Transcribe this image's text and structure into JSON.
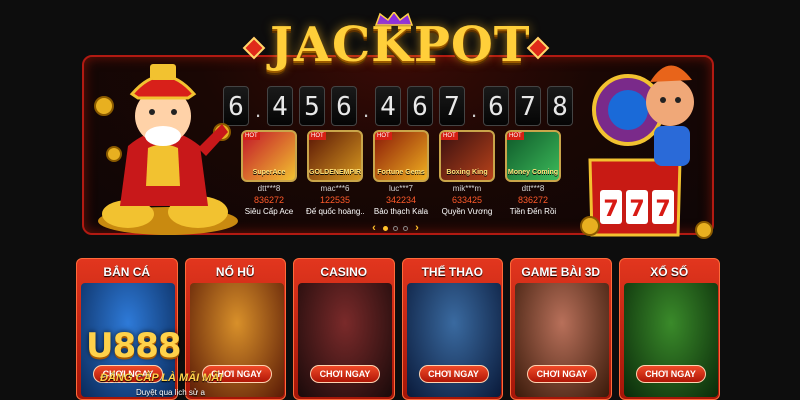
{
  "jackpot": {
    "title": "JACKPOT",
    "digits": [
      "6",
      "4",
      "5",
      "6",
      "4",
      "6",
      "7",
      "6",
      "7",
      "8"
    ],
    "separators": [
      ".",
      ".",
      "."
    ]
  },
  "games": [
    {
      "badge": "HOT",
      "thumb_text": "SuperAce",
      "user": "dtt***8",
      "score": "836272",
      "title": "Siêu Cấp Ace",
      "colors": [
        "#c2172a",
        "#f2c230"
      ]
    },
    {
      "badge": "HOT",
      "thumb_text": "GOLDENEMPIRE",
      "user": "mac***6",
      "score": "122535",
      "title": "Đế quốc hoàng...",
      "colors": [
        "#5a1606",
        "#d89a20"
      ]
    },
    {
      "badge": "HOT",
      "thumb_text": "Fortune Gems",
      "user": "luc***7",
      "score": "342234",
      "title": "Bảo thạch Kala",
      "colors": [
        "#8a1a08",
        "#f0b020"
      ]
    },
    {
      "badge": "HOT",
      "thumb_text": "Boxing King",
      "user": "mik***m",
      "score": "633425",
      "title": "Quyền Vương",
      "colors": [
        "#3a1010",
        "#b8421a"
      ]
    },
    {
      "badge": "HOT",
      "thumb_text": "Money Coming",
      "user": "dtt***8",
      "score": "836272",
      "title": "Tiền Đến Rồi",
      "colors": [
        "#0f5a2a",
        "#3cba5a"
      ]
    }
  ],
  "pager": {
    "prev": "‹",
    "next": "›",
    "active_index": 0,
    "count": 3
  },
  "categories": [
    {
      "label": "BẮN CÁ",
      "button": "CHƠI NGAY",
      "colors": [
        "#0a2a5a",
        "#2e7ad8"
      ]
    },
    {
      "label": "NỔ HŨ",
      "button": "CHƠI NGAY",
      "colors": [
        "#5a1a06",
        "#d8902a"
      ]
    },
    {
      "label": "CASINO",
      "button": "CHƠI NGAY",
      "colors": [
        "#1a0a0a",
        "#7a2a2a"
      ]
    },
    {
      "label": "THỂ THAO",
      "button": "CHƠI NGAY",
      "colors": [
        "#0a1a3a",
        "#3a6aa0"
      ]
    },
    {
      "label": "GAME BÀI 3D",
      "button": "CHƠI NGAY",
      "colors": [
        "#3a1a0a",
        "#b8705a"
      ]
    },
    {
      "label": "XỔ SỐ",
      "button": "CHƠI NGAY",
      "colors": [
        "#0a2a0a",
        "#3a8a2a"
      ]
    }
  ],
  "watermark": {
    "logo": "U888",
    "tagline": "ĐẲNG CẤP LÀ MÃI MÃI",
    "sub": "Duyệt qua lịch sử a"
  }
}
